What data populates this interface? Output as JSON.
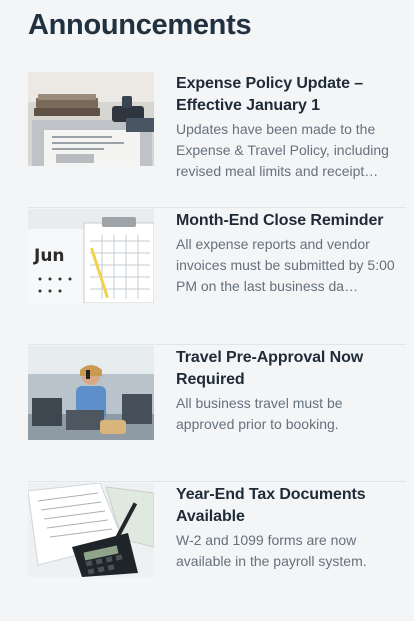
{
  "header": {
    "title": "Announcements"
  },
  "announcements": [
    {
      "title": "Expense Policy Update – Effective January 1",
      "body": "Updates have been made to the Expense & Travel Policy, including revised meal limits and receipt…",
      "thumbnail": "office-desk-stamp-image"
    },
    {
      "title": "Month-End Close Reminder",
      "body": "All expense reports and vendor invoices must be submitted by 5:00 PM on the last business da…",
      "thumbnail": "calendar-june-clipboard-image"
    },
    {
      "title": "Travel Pre-Approval Now Required",
      "body": "All business travel must be approved prior to booking.",
      "thumbnail": "traveler-airport-phone-image"
    },
    {
      "title": "Year-End Tax Documents Available",
      "body": "W-2 and 1099 forms are now available in the payroll system.",
      "thumbnail": "tax-forms-calculator-image"
    }
  ]
}
